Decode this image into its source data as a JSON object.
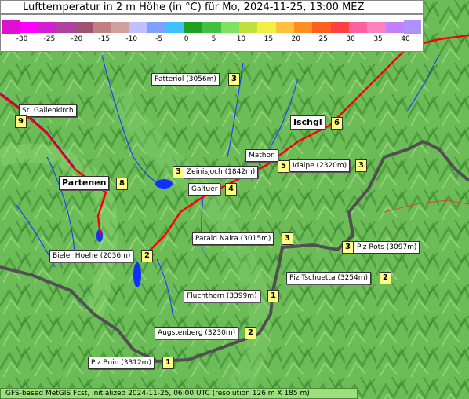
{
  "title": "Lufttemperatur in 2 m Höhe (in °C) für Mo, 2024-11-25, 13:00 MEZ",
  "legend": {
    "ticks": [
      "-30",
      "-25",
      "-20",
      "-15",
      "-10",
      "-5",
      "0",
      "5",
      "10",
      "15",
      "20",
      "25",
      "30",
      "35",
      "40"
    ],
    "colors": [
      "#ff00ff",
      "#d020d0",
      "#b040a0",
      "#a05070",
      "#c08080",
      "#d0a0a0",
      "#c0c0ff",
      "#80a0ff",
      "#40c0ff",
      "#20a020",
      "#40c040",
      "#80e060",
      "#c0e040",
      "#f0f040",
      "#ffc040",
      "#ff9020",
      "#ff6020",
      "#ff4040",
      "#ff60a0",
      "#ff80c0",
      "#c080ff"
    ]
  },
  "places": [
    {
      "name": "Patteriol (3056m)",
      "value": "3"
    },
    {
      "name": "St. Gallenkirch",
      "value": "9"
    },
    {
      "name": "Ischgl",
      "value": "6"
    },
    {
      "name": "Mathon",
      "value": "5"
    },
    {
      "name": "Idalpe (2320m)",
      "value": "3"
    },
    {
      "name": "Zeinisjoch (1842m)",
      "value": "3"
    },
    {
      "name": "Partenen",
      "value": "8"
    },
    {
      "name": "Galtuer",
      "value": "4"
    },
    {
      "name": "Paraid Naira (3015m)",
      "value": "3"
    },
    {
      "name": "Piz Rots (3097m)",
      "value": "3"
    },
    {
      "name": "Bieler Hoehe (2036m)",
      "value": "2"
    },
    {
      "name": "Piz Tschuetta (3254m)",
      "value": "2"
    },
    {
      "name": "Fluchthorn (3399m)",
      "value": "1"
    },
    {
      "name": "Augstenberg (3230m)",
      "value": "2"
    },
    {
      "name": "Piz Buin (3312m)",
      "value": "1"
    }
  ],
  "footer": "GFS-based MetGIS Fcst, initialized 2024-11-25, 06:00 UTC  (resolution 126 m X 185 m)"
}
